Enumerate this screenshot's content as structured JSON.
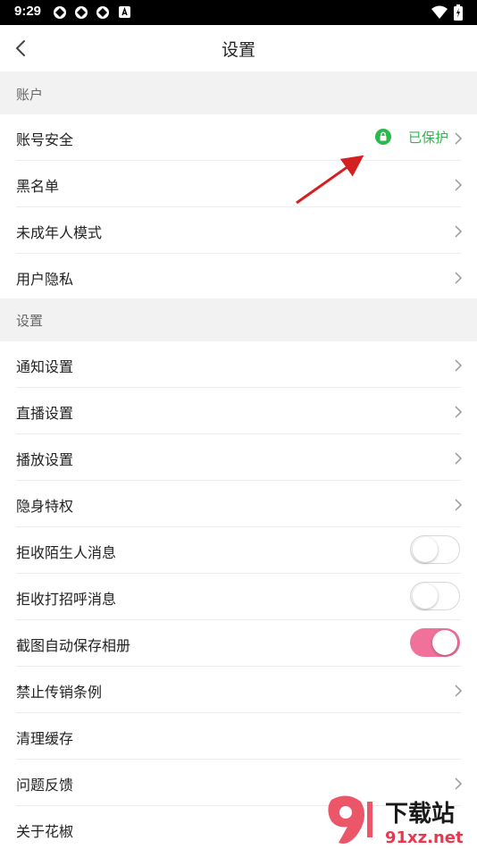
{
  "status_bar": {
    "time": "9:29"
  },
  "nav": {
    "title": "设置"
  },
  "sections": {
    "account": "账户",
    "settings": "设置"
  },
  "rows": {
    "account_security": "账号安全",
    "account_security_status": "已保护",
    "blacklist": "黑名单",
    "minor_mode": "未成年人模式",
    "user_privacy": "用户隐私",
    "notification_settings": "通知设置",
    "live_settings": "直播设置",
    "playback_settings": "播放设置",
    "invisible_privilege": "隐身特权",
    "reject_stranger_messages": "拒收陌生人消息",
    "reject_greeting_messages": "拒收打招呼消息",
    "screenshot_autosave": "截图自动保存相册",
    "mlm_regulations": "禁止传销条例",
    "clear_cache": "清理缓存",
    "feedback": "问题反馈",
    "about": "关于花椒"
  },
  "toggles": {
    "reject_stranger_messages": false,
    "reject_greeting_messages": false,
    "screenshot_autosave": true
  },
  "colors": {
    "accent_toggle_on": "#f0719a",
    "protected_green": "#2db84d",
    "annotation_arrow": "#d42020"
  },
  "watermark": {
    "text_main": "下载站",
    "text_sub": "91xz.net"
  }
}
